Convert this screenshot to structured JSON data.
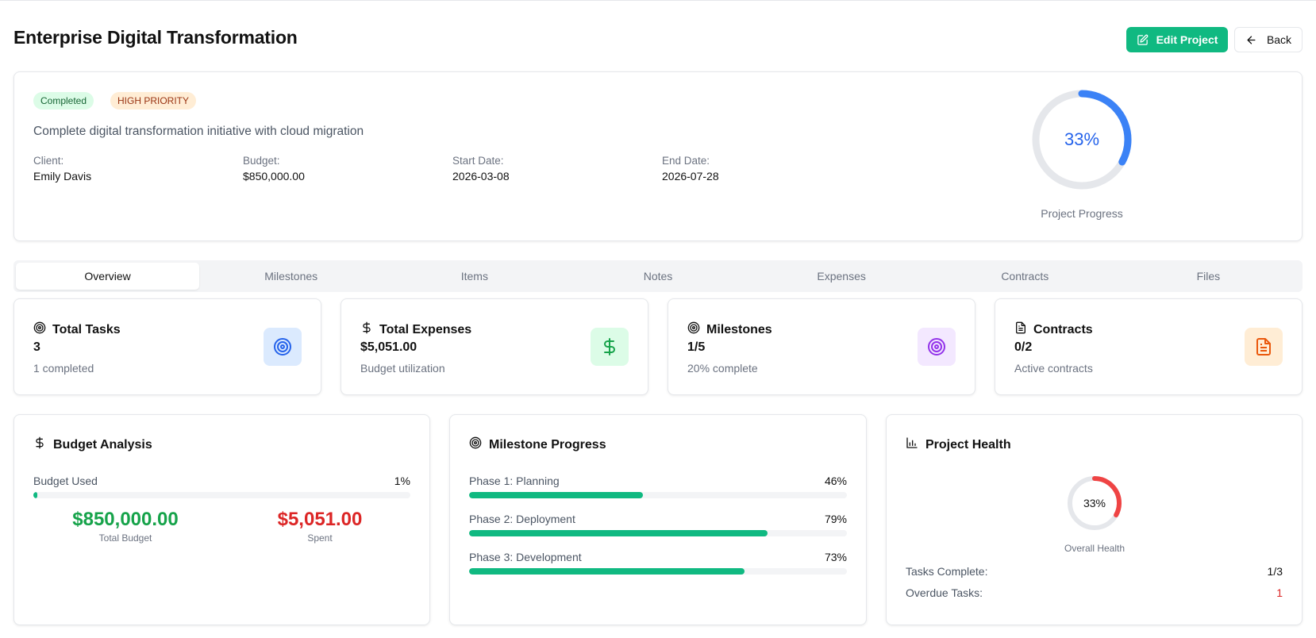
{
  "header": {
    "title": "Enterprise Digital Transformation",
    "edit_label": "Edit Project",
    "back_label": "Back"
  },
  "project": {
    "status": "Completed",
    "priority": "HIGH PRIORITY",
    "description": "Complete digital transformation initiative with cloud migration",
    "fields": [
      {
        "label": "Client:",
        "value": "Emily Davis"
      },
      {
        "label": "Budget:",
        "value": "$850,000.00"
      },
      {
        "label": "Start Date:",
        "value": "2026-03-08"
      },
      {
        "label": "End Date:",
        "value": "2026-07-28"
      }
    ],
    "progress_text": "33%",
    "progress_value": 0.33,
    "progress_caption": "Project Progress"
  },
  "tabs": [
    "Overview",
    "Milestones",
    "Items",
    "Notes",
    "Expenses",
    "Contracts",
    "Files"
  ],
  "active_tab": "Overview",
  "stats": [
    {
      "title": "Total Tasks",
      "value": "3",
      "sub": "1 completed",
      "icon": "target-icon"
    },
    {
      "title": "Total Expenses",
      "value": "$5,051.00",
      "sub": "Budget utilization",
      "icon": "dollar-icon"
    },
    {
      "title": "Milestones",
      "value": "1/5",
      "sub": "20% complete",
      "icon": "target-icon"
    },
    {
      "title": "Contracts",
      "value": "0/2",
      "sub": "Active contracts",
      "icon": "document-icon"
    }
  ],
  "budget": {
    "title": "Budget Analysis",
    "used_label": "Budget Used",
    "used_pct_text": "1%",
    "used_value": 0.01,
    "total_value": "$850,000.00",
    "total_label": "Total Budget",
    "spent_value": "$5,051.00",
    "spent_label": "Spent"
  },
  "milestones": {
    "title": "Milestone Progress",
    "items": [
      {
        "label": "Phase 1: Planning",
        "pct_text": "46%",
        "value": 0.46
      },
      {
        "label": "Phase 2: Deployment",
        "pct_text": "79%",
        "value": 0.79
      },
      {
        "label": "Phase 3: Development",
        "pct_text": "73%",
        "value": 0.73
      }
    ]
  },
  "health": {
    "title": "Project Health",
    "pct_text": "33%",
    "value": 0.33,
    "caption": "Overall Health",
    "tasks_label": "Tasks Complete:",
    "tasks_value": "1/3",
    "overdue_label": "Overdue Tasks:",
    "overdue_value": "1"
  },
  "colors": {
    "accent": "#10b981",
    "progress_blue": "#3b82f6",
    "health_red": "#ef4444",
    "money_green": "#16a34a",
    "money_red": "#dc2626"
  }
}
